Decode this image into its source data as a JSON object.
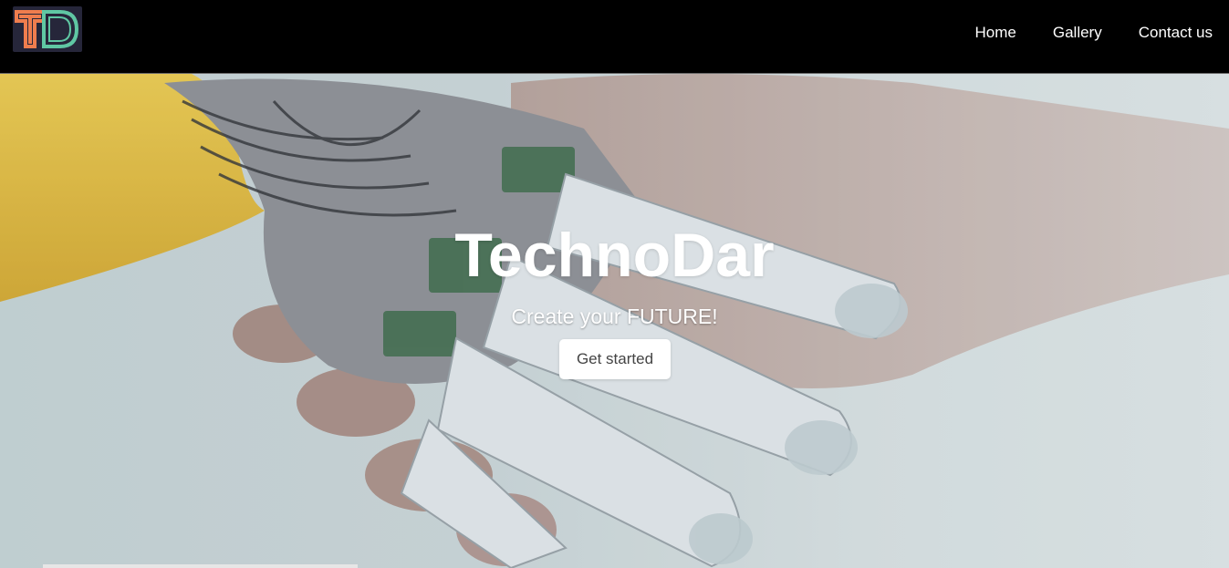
{
  "brand": {
    "logo_text": "TD"
  },
  "nav": {
    "items": [
      {
        "label": "Home"
      },
      {
        "label": "Gallery"
      },
      {
        "label": "Contact us"
      }
    ]
  },
  "hero": {
    "title": "TechnoDar",
    "subtitle": "Create your FUTURE!",
    "cta_label": "Get started",
    "background_image": "robot-and-human-hands"
  },
  "colors": {
    "nav_bg": "#000000",
    "logo_orange": "#ef7d4e",
    "logo_green": "#5fc7a3",
    "cta_bg": "#ffffff",
    "robot_arm_yellow": "#f0c43c"
  }
}
